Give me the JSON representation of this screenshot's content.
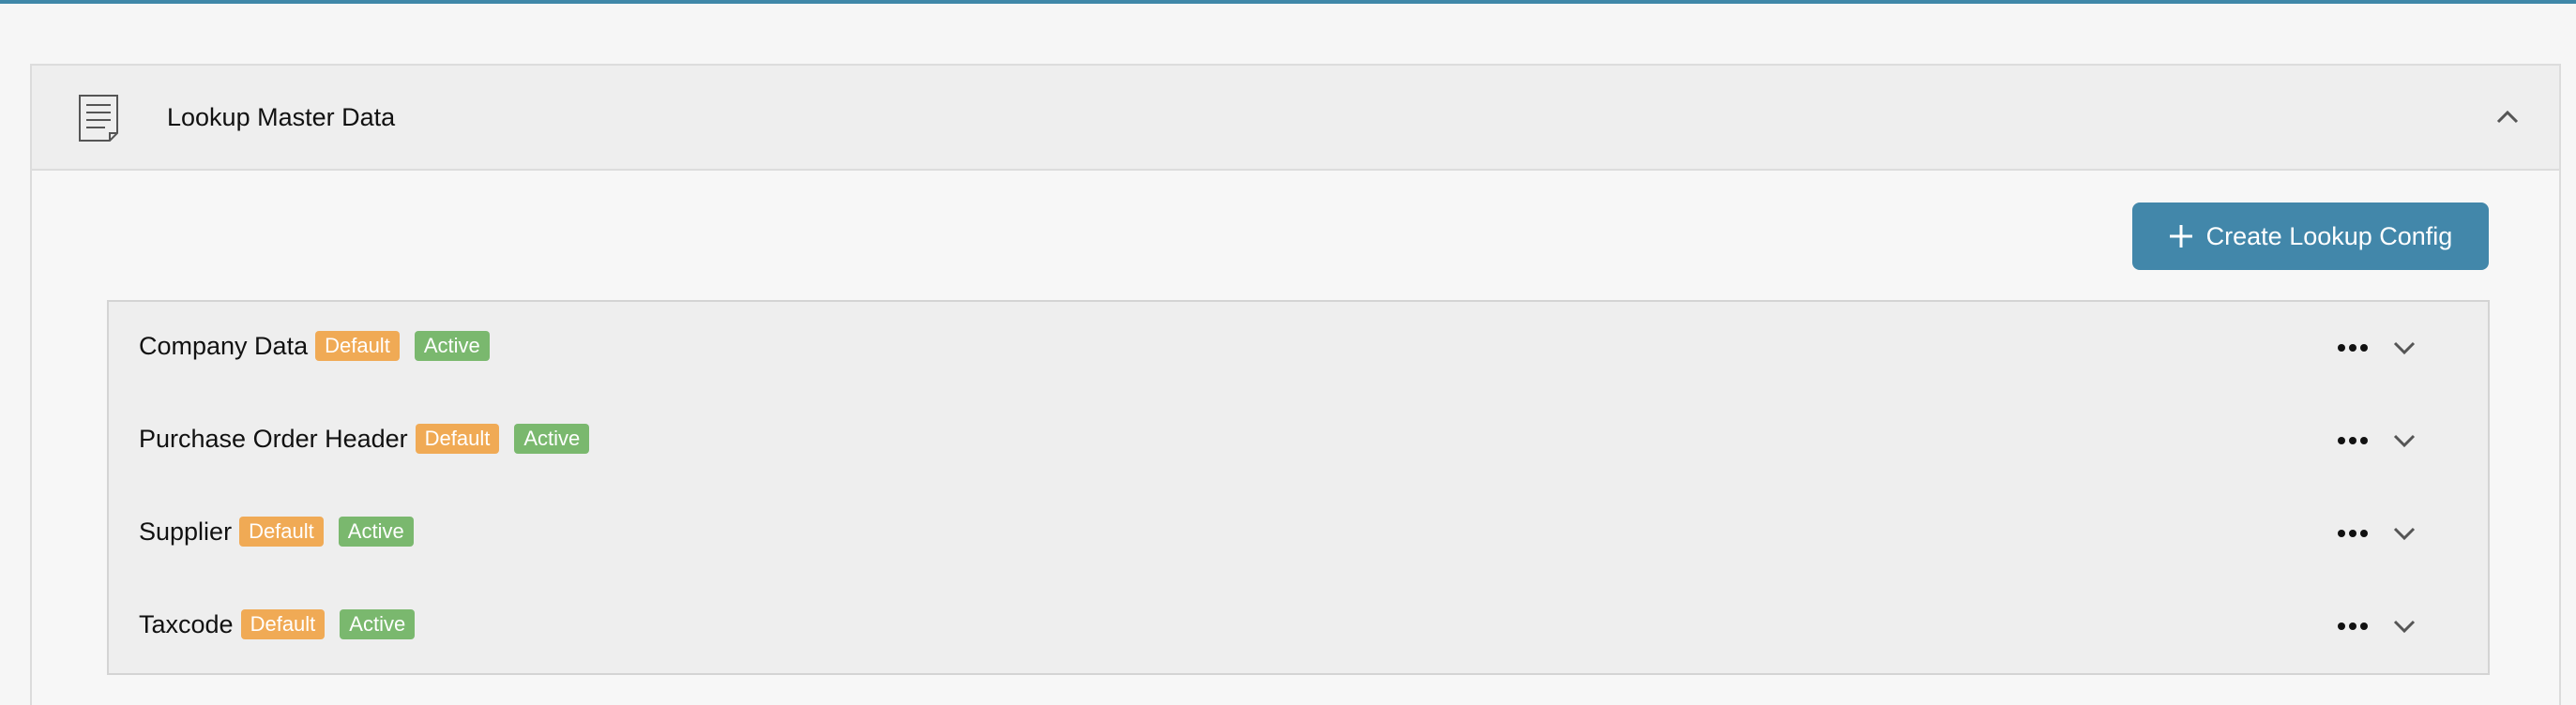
{
  "section": {
    "title": "Lookup Master Data",
    "icon": "document-icon",
    "collapse_icon": "chevron-up-icon"
  },
  "toolbar": {
    "create_label": "Create Lookup Config",
    "create_icon": "plus-icon"
  },
  "items": [
    {
      "name": "Company Data",
      "default_badge": "Default",
      "status_badge": "Active"
    },
    {
      "name": "Purchase Order Header",
      "default_badge": "Default",
      "status_badge": "Active"
    },
    {
      "name": "Supplier",
      "default_badge": "Default",
      "status_badge": "Active"
    },
    {
      "name": "Taxcode",
      "default_badge": "Default",
      "status_badge": "Active"
    }
  ],
  "colors": {
    "accent": "#4287aa",
    "default_badge": "#f0aa55",
    "active_badge": "#7ab86e"
  }
}
